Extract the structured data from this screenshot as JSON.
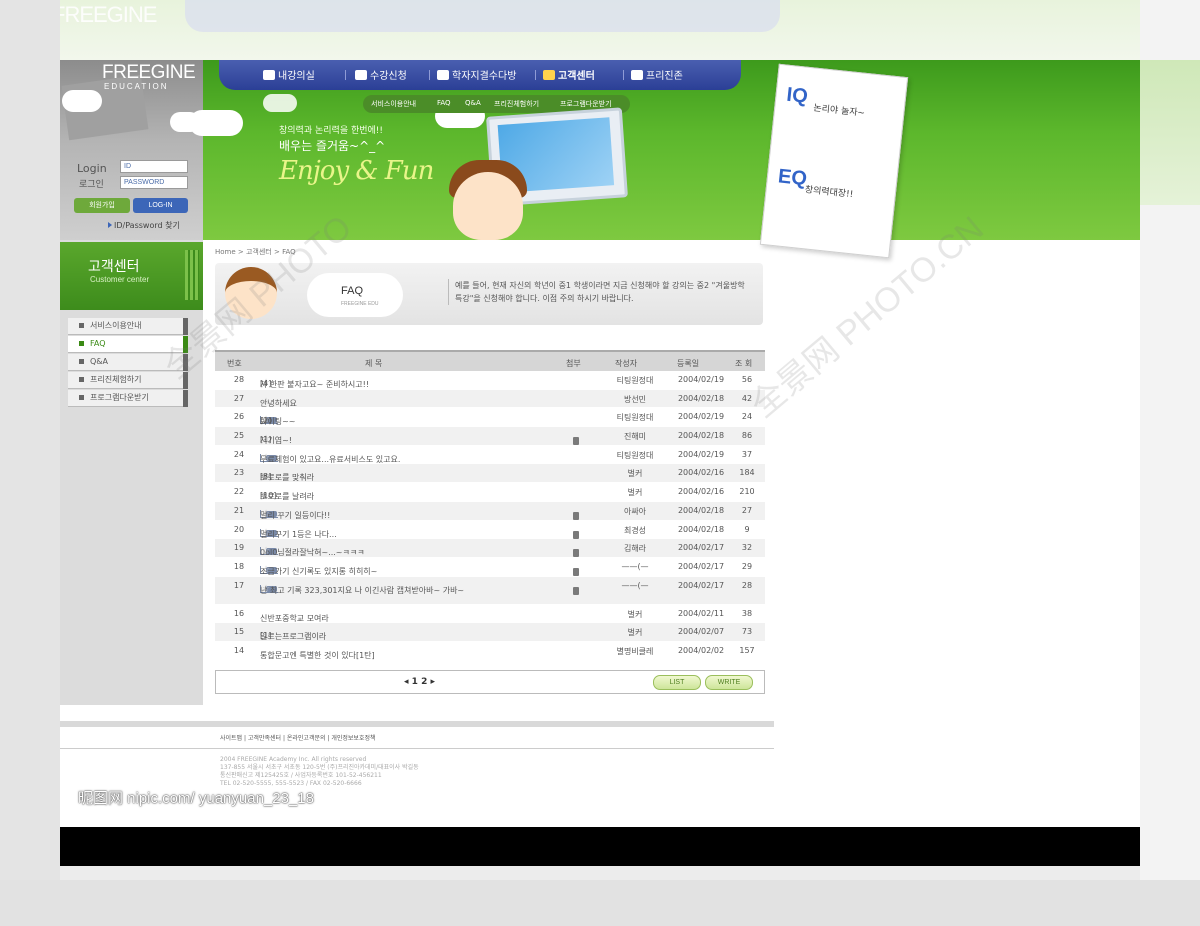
{
  "brand": {
    "title": "FREEGINE",
    "subtitle": "EDUCATION"
  },
  "login": {
    "label_en": "Login",
    "label_kr": "로그인",
    "id_placeholder": "ID",
    "password_placeholder": "PASSWORD",
    "join_label": "회원가입",
    "login_label": "LOG-IN",
    "find_label": "ID/Password 찾기"
  },
  "nav": {
    "items": [
      {
        "label": "내강의실",
        "icon": "book-icon"
      },
      {
        "label": "수강신청",
        "icon": "pencil-icon"
      },
      {
        "label": "학자지결수다방",
        "icon": "cup-icon"
      },
      {
        "label": "고객센터",
        "icon": "headset-icon",
        "active": true
      },
      {
        "label": "프리진존",
        "icon": "leaf-icon"
      }
    ],
    "subnav": [
      "서비스이용안내",
      "FAQ",
      "Q&A",
      "프리진체험하기",
      "프로그램다운받기"
    ]
  },
  "banner": {
    "slogan1": "창의력과 논리력을 한번에!!",
    "slogan2": "배우는 즐거움~^_^",
    "enjoy": "Enjoy & Fun",
    "card": {
      "iq_label": "IQ",
      "iq_text": "논리야 놀자~",
      "eq_label": "EQ",
      "eq_text": "창의력대장!!"
    }
  },
  "sidebar": {
    "title": "고객센터",
    "subtitle": "Customer center",
    "items": [
      {
        "label": "서비스이용안내",
        "active": false
      },
      {
        "label": "FAQ",
        "active": true
      },
      {
        "label": "Q&A",
        "active": false
      },
      {
        "label": "프리진체험하기",
        "active": false
      },
      {
        "label": "프로그램다운받기",
        "active": false
      }
    ]
  },
  "breadcrumb": "Home > 고객센터 > FAQ",
  "faq": {
    "heading": "FAQ",
    "heading_sub": "FREEGINE EDU",
    "description": "예를 들어, 현재 자신의 학년이 중1 학생이라면 지금 신청해야 할 강의는 중2 \"겨울방학 특강\"을 신청해야 합니다. 이점 주의 하시기 바랍니다."
  },
  "table": {
    "headers": {
      "no": "번호",
      "title": "제 목",
      "attach": "첨부",
      "writer": "작성자",
      "date": "등록일",
      "hits": "조 회"
    },
    "rows": [
      {
        "no": "28",
        "title": "자 한판 붙자고요~ 준비하시고!!",
        "suffix": "[4]",
        "reply": false,
        "star": true,
        "attach": false,
        "writer": "티팅원정대",
        "date": "2004/02/19",
        "hits": "56"
      },
      {
        "no": "27",
        "title": "안녕하세요",
        "suffix": "",
        "reply": false,
        "star": true,
        "attach": false,
        "writer": "방선민",
        "date": "2004/02/18",
        "hits": "42"
      },
      {
        "no": "26",
        "title": "화이팅~~",
        "suffix": "[2]",
        "reply": true,
        "star": true,
        "attach": false,
        "writer": "티팅원정대",
        "date": "2004/02/19",
        "hits": "24"
      },
      {
        "no": "25",
        "title": "저기염~!",
        "suffix": "[1]",
        "reply": false,
        "star": true,
        "attach": true,
        "writer": "진해미",
        "date": "2004/02/18",
        "hits": "86"
      },
      {
        "no": "24",
        "title": "무료체험이 있고요...유료서비스도 있고요.",
        "suffix": "",
        "reply": true,
        "star": true,
        "attach": false,
        "writer": "티팅원정대",
        "date": "2004/02/19",
        "hits": "37"
      },
      {
        "no": "23",
        "title": "뽀로로를 맞춰라",
        "suffix": "[3]",
        "reply": false,
        "star": false,
        "attach": false,
        "writer": "벌커",
        "date": "2004/02/16",
        "hits": "184"
      },
      {
        "no": "22",
        "title": "뽀로로를 날려라",
        "suffix": "[10]",
        "reply": false,
        "star": false,
        "attach": false,
        "writer": "벌커",
        "date": "2004/02/16",
        "hits": "210"
      },
      {
        "no": "21",
        "title": "멀리 꾸기 일등이다!!",
        "suffix": "",
        "reply": true,
        "star": true,
        "attach": true,
        "writer": "아싸아",
        "date": "2004/02/18",
        "hits": "27"
      },
      {
        "no": "20",
        "title": "멀리꾸기 1등은 나다...",
        "suffix": "",
        "reply": true,
        "star": true,
        "attach": true,
        "writer": "최경성",
        "date": "2004/02/18",
        "hits": "9"
      },
      {
        "no": "19",
        "title": "0ol0님절라잘낙혀~...~ㅋㅋㅋ",
        "suffix": "",
        "reply": true,
        "star": true,
        "attach": true,
        "writer": "김해라",
        "date": "2004/02/17",
        "hits": "32"
      },
      {
        "no": "18",
        "title": "조금가기 신기록도 있지롱 히히히~",
        "suffix": "",
        "reply": true,
        "star": true,
        "attach": true,
        "writer": "——(—",
        "date": "2004/02/17",
        "hits": "29"
      },
      {
        "no": "17",
        "title": "난 최고 기록 323,301지요 나 이긴사람 캡쳐받아바~ 가바~",
        "suffix": "",
        "reply": true,
        "star": true,
        "attach": true,
        "writer": "——(—",
        "date": "2004/02/17",
        "hits": "28"
      },
      {
        "no": "16",
        "title": "신반포중학교 모여라",
        "suffix": "",
        "reply": false,
        "star": false,
        "attach": false,
        "writer": "벌커",
        "date": "2004/02/11",
        "hits": "38"
      },
      {
        "no": "15",
        "title": "일르는프로그램이라",
        "suffix": "[1]",
        "reply": false,
        "star": false,
        "attach": false,
        "writer": "벌커",
        "date": "2004/02/07",
        "hits": "73"
      },
      {
        "no": "14",
        "title": "통합문고엔 특별한 것이 있다[1탄]",
        "suffix": "",
        "reply": false,
        "star": false,
        "attach": false,
        "writer": "별명비클레",
        "date": "2004/02/02",
        "hits": "157"
      }
    ]
  },
  "pager": {
    "prev": "◂",
    "pages": "1 2",
    "next": "▸",
    "list_label": "LIST",
    "write_label": "WRITE"
  },
  "footer": {
    "links": "사이트맵  |  고객만족센터  |  온라인고객문의  |  개인정보보호정책",
    "copy1": "2004 FREEGINE Academy Inc. All rights reserved",
    "copy2": "137-855 서울시 서초구 서초동 120-5번 (주)프리진아카데미/대표이사 박길동",
    "copy3": "통신판매신고 제125425호 / 사업자등록번호 101-52-456211",
    "copy4": "TEL 02-520-5555, 555-5523 / FAX 02-520-6666"
  },
  "watermark": "昵图网 nipic.com/ yuanyuan_23_18",
  "colors": {
    "green": "#5cb72c",
    "nav_blue": "#2b3f96",
    "accent_link": "#3c66b8"
  }
}
